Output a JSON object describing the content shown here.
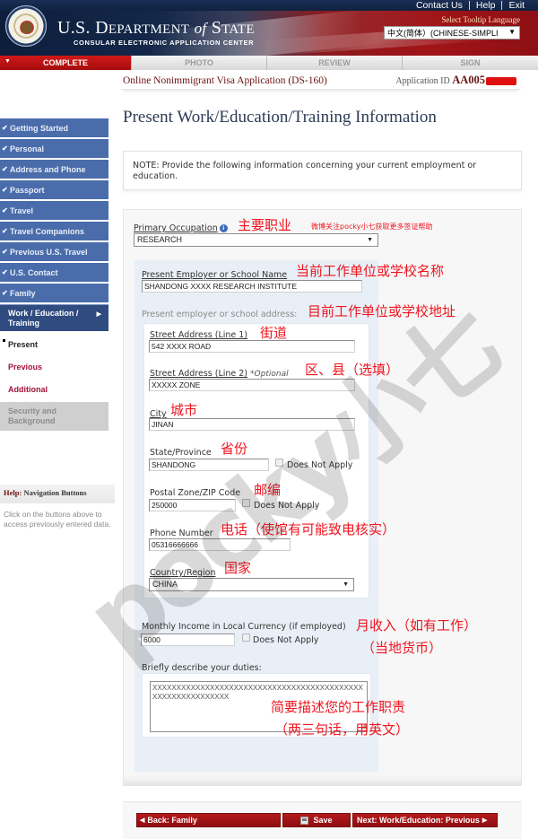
{
  "header": {
    "top_links": [
      "Contact Us",
      "Help",
      "Exit"
    ],
    "dept_title_main": "U.S. D",
    "dept_title_caps": "EPARTMENT",
    "dept_title_of": "of",
    "dept_title_state": "S",
    "dept_title_state_caps": "TATE",
    "dept_subtitle": "CONSULAR ELECTRONIC APPLICATION CENTER",
    "tooltip_language_label": "Select Tooltip Language",
    "tooltip_language_value": "中文(简体）(CHINESE-SIMPLI"
  },
  "steps": [
    {
      "label": "COMPLETE",
      "active": true
    },
    {
      "label": "PHOTO",
      "active": false
    },
    {
      "label": "REVIEW",
      "active": false
    },
    {
      "label": "SIGN",
      "active": false
    }
  ],
  "application": {
    "name": "Online Nonimmigrant Visa Application (DS-160)",
    "id_label": "Application ID",
    "id_value": "AA005"
  },
  "page_title": "Present Work/Education/Training Information",
  "sidebar": {
    "completed": [
      "Getting Started",
      "Personal",
      "Address and Phone",
      "Passport",
      "Travel",
      "Travel Companions",
      "Previous U.S. Travel",
      "U.S. Contact",
      "Family"
    ],
    "current_section_line1": "Work / Education /",
    "current_section_line2": "Training",
    "sub_items": [
      {
        "label": "Present",
        "state": "current"
      },
      {
        "label": "Previous",
        "state": "link"
      },
      {
        "label": "Additional",
        "state": "link"
      }
    ],
    "disabled_line1": "Security and",
    "disabled_line2": "Background"
  },
  "help": {
    "title_prefix": "Help:",
    "title_rest": "Navigation Buttons",
    "text": "Click on the buttons above to access previously entered data."
  },
  "note": "NOTE: Provide the following information concerning your current employment or education.",
  "form": {
    "primary_occupation": {
      "label": "Primary Occupation",
      "value": "RESEARCH"
    },
    "employer_name": {
      "label": "Present Employer or School Name",
      "value": "SHANDONG XXXX RESEARCH INSTITUTE"
    },
    "address_heading": "Present employer or school address:",
    "street1": {
      "label": "Street Address (Line 1)",
      "value": "542 XXXX ROAD"
    },
    "street2": {
      "label": "Street Address (Line 2)",
      "optional": "*Optional",
      "value": "XXXXX ZONE"
    },
    "city": {
      "label": "City",
      "value": "JINAN"
    },
    "state": {
      "label": "State/Province",
      "value": "SHANDONG",
      "does_not_apply": "Does Not Apply"
    },
    "postal": {
      "label": "Postal Zone/ZIP Code",
      "value": "250000",
      "does_not_apply": "Does Not Apply"
    },
    "phone": {
      "label": "Phone Number",
      "value": "05316666666"
    },
    "country": {
      "label": "Country/Region",
      "value": "CHINA"
    },
    "income": {
      "label": "Monthly Income in Local Currency (if employed)",
      "value": "6000",
      "does_not_apply": "Does Not Apply"
    },
    "duties": {
      "label": "Briefly describe your duties:",
      "value": "XXXXXXXXXXXXXXXXXXXXXXXXXXXXXXXXXXXXXXXXXXXXXXXXXXXXXXXXXXXX"
    }
  },
  "annotations": {
    "occupation": "主要职业",
    "occupation_note": "微博关注pocky小七获取更多签证帮助",
    "employer_name": "当前工作单位或学校名称",
    "employer_address": "目前工作单位或学校地址",
    "street1": "街道",
    "street2": "区、县（选填）",
    "city": "城市",
    "state": "省份",
    "postal": "邮编",
    "phone": "电话（使馆有可能致电核实）",
    "country": "国家",
    "income_line1": "月收入（如有工作）",
    "income_line2": "（当地货币）",
    "duties_line1": "简要描述您的工作职责",
    "duties_line2": "（两三句话，用英文）"
  },
  "watermark": "pocky小七",
  "buttons": {
    "back": "Back: Family",
    "save": "Save",
    "next": "Next: Work/Education: Previous"
  }
}
